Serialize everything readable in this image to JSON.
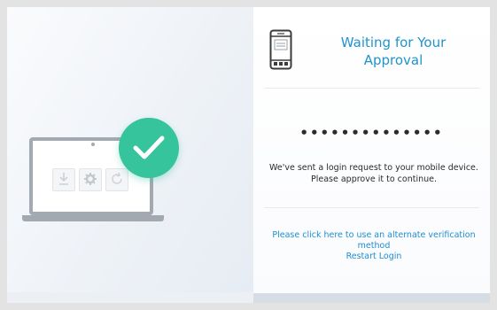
{
  "approval": {
    "title_line1": "Waiting for Your",
    "title_line2": "Approval",
    "masked_code": "••••••••••••••",
    "message": "We've sent a login request to your mobile device. Please approve it to continue.",
    "alternate_method_link": "Please click here to use an alternate verification method",
    "restart_link": "Restart Login"
  },
  "icons": {
    "phone": "mobile-phone-icon",
    "check": "checkmark-icon",
    "download": "download-icon",
    "settings": "gear-icon",
    "refresh": "refresh-icon"
  },
  "colors": {
    "accent": "#1f94cc",
    "link": "#1f8dd0",
    "success": "#35c49b"
  }
}
